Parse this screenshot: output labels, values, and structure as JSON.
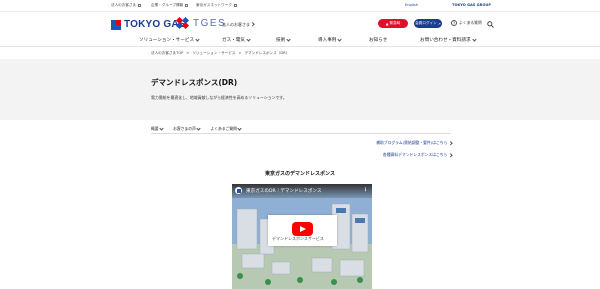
{
  "utility": {
    "links": [
      "法人のお客さま",
      "企業・グループ情報",
      "東京ガスネットワーク"
    ],
    "lang": "English",
    "group": "TOKYO GAS GROUP"
  },
  "header": {
    "brand_tokyo": "TOKYO GAS",
    "brand_tges": "TGES",
    "corp_link": "法人のお客さま",
    "btn_emergency": "緊急時",
    "btn_member": "会員ログイン",
    "faq": "よくある質問"
  },
  "nav": {
    "items": [
      "ソリューション・サービス",
      "ガス・電気",
      "技術",
      "導入事例",
      "お知らせ",
      "お問い合わせ・資料請求"
    ]
  },
  "breadcrumb": [
    "法人のお客さまTOP",
    "ソリューション・サービス",
    "デマンドレスポンス（DR）"
  ],
  "page": {
    "title": "デマンドレスポンス(DR)",
    "lead": "電力需給を最適化し、地域貢献しながら経済性を高めるソリューションです。"
  },
  "anchors": [
    "概要",
    "お客さまの声",
    "よくあるご質問"
  ],
  "links": {
    "link1": "補助プログラム(需給調整・要件)はこちら",
    "link2": "各種資料デマンドレスポンスはこちら"
  },
  "video": {
    "heading": "東京ガスのデマンドレスポンス",
    "title": "東京ガスのDR｜デマンドレスポンス",
    "card_text": "デマンドレスポンスサービス"
  },
  "colors": {
    "brand_blue": "#1a3d8f",
    "emergency_red": "#e0102d",
    "band_gray": "#f3f3f3"
  }
}
